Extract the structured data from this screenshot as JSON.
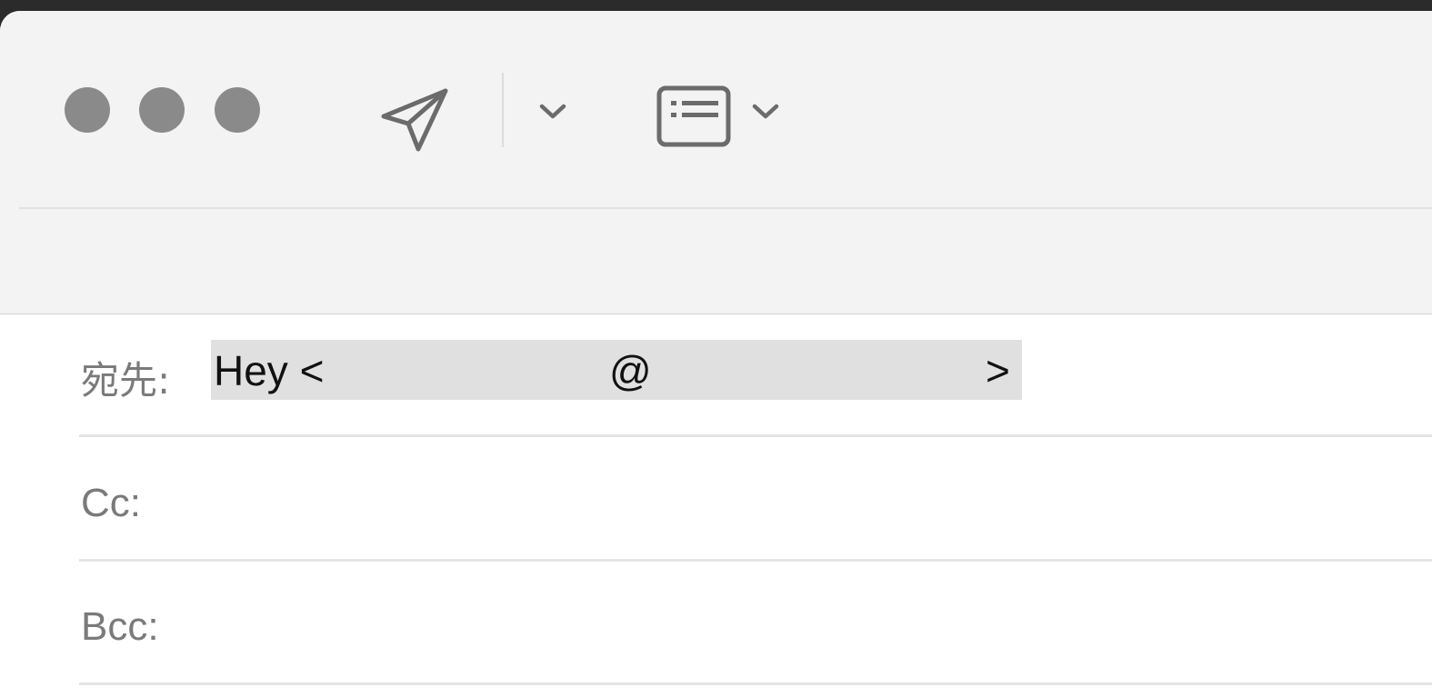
{
  "window": {
    "traffic_lights": {
      "close": "close-window",
      "minimize": "minimize-window",
      "zoom": "zoom-window",
      "color": "#8a8a8a"
    }
  },
  "toolbar": {
    "send_icon": "paper-plane-icon",
    "send_menu_icon": "chevron-down-icon",
    "header_fields_icon": "list-card-icon",
    "header_fields_menu_icon": "chevron-down-icon",
    "background": "#f3f3f3"
  },
  "fields": {
    "to": {
      "label": "宛先:",
      "recipient": {
        "name_part": "Hey <",
        "at_sign": "@",
        "close_bracket": ">",
        "highlight": "#e0e0e0"
      }
    },
    "cc": {
      "label": "Cc:"
    },
    "bcc": {
      "label": "Bcc:"
    }
  }
}
